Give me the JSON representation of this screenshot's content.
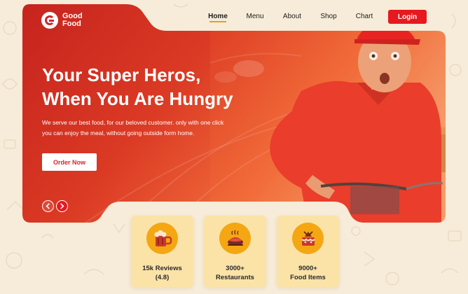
{
  "brand": {
    "name_line1": "Good",
    "name_line2": "Food",
    "logo_icon": "g-logo-icon"
  },
  "nav": {
    "items": [
      {
        "label": "Home",
        "active": true
      },
      {
        "label": "Menu",
        "active": false
      },
      {
        "label": "About",
        "active": false
      },
      {
        "label": "Shop",
        "active": false
      },
      {
        "label": "Chart",
        "active": false
      }
    ],
    "login_label": "Login"
  },
  "hero": {
    "title_line1": "Your Super Heros,",
    "title_line2": "When You Are Hungry",
    "description_line1": "We serve our best food, for our beloved customer. only with one click",
    "description_line2": "you can enjoy the meal, without going outside form home.",
    "cta_label": "Order Now",
    "prev_icon": "chevron-left-icon",
    "next_icon": "chevron-right-icon"
  },
  "stats": [
    {
      "line1": "15k Reviews",
      "line2": "(4.8)",
      "icon": "beer-mug-icon"
    },
    {
      "line1": "3000+",
      "line2": "Restaurants",
      "icon": "hot-dish-icon"
    },
    {
      "line1": "9000+",
      "line2": "Food Items",
      "icon": "cake-icon"
    }
  ],
  "colors": {
    "primary_red": "#e5191f",
    "hero_red": "#d42a22",
    "accent_orange": "#f4a712",
    "card_bg": "#fbe3a8",
    "page_bg": "#f6ecd9"
  }
}
